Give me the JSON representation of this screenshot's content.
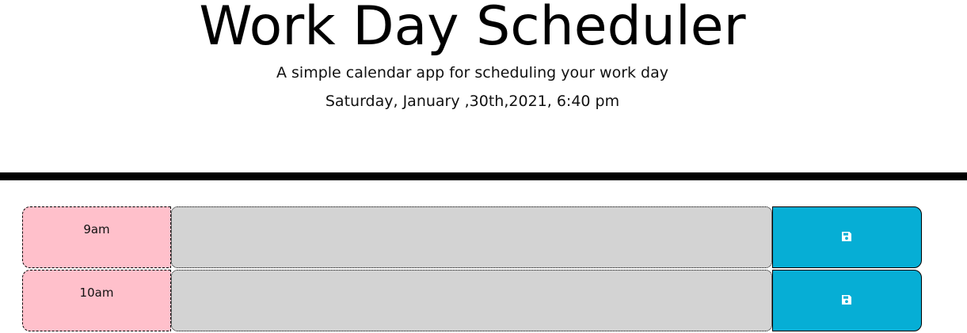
{
  "header": {
    "title": "Work Day Scheduler",
    "subtitle": "A simple calendar app for scheduling your work day",
    "current_date": "Saturday, January ,30th,2021, 6:40 pm"
  },
  "colors": {
    "past": "#ffc0cb",
    "task_bg": "#d3d3d3",
    "save_bg": "#06aed5"
  },
  "rows": [
    {
      "hour": "9am",
      "task": "",
      "save_icon": "save-icon"
    },
    {
      "hour": "10am",
      "task": "",
      "save_icon": "save-icon"
    }
  ]
}
